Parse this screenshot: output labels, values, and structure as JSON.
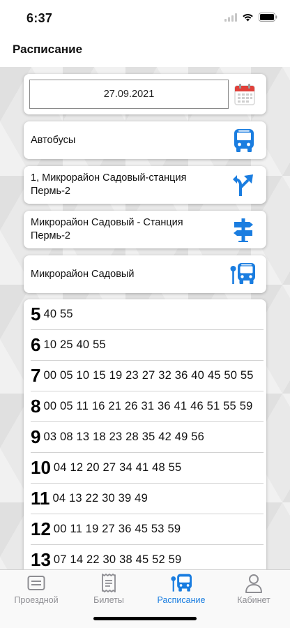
{
  "status": {
    "time": "6:37"
  },
  "nav": {
    "title": "Расписание"
  },
  "date": {
    "value": "27.09.2021"
  },
  "transport_type": {
    "label": "Автобусы"
  },
  "route": {
    "label": "1, Микрорайон Садовый-станция Пермь-2"
  },
  "direction": {
    "label": "Микрорайон Садовый - Станция Пермь-2"
  },
  "stop": {
    "label": "Микрорайон Садовый"
  },
  "schedule": [
    {
      "hour": "5",
      "minutes": "40 55"
    },
    {
      "hour": "6",
      "minutes": "10 25 40 55"
    },
    {
      "hour": "7",
      "minutes": "00 05 10 15 19 23 27 32 36 40 45 50 55"
    },
    {
      "hour": "8",
      "minutes": "00 05 11 16 21 26 31 36 41 46 51 55 59"
    },
    {
      "hour": "9",
      "minutes": "03 08 13 18 23 28 35 42 49 56"
    },
    {
      "hour": "10",
      "minutes": "04 12 20 27 34 41 48 55"
    },
    {
      "hour": "11",
      "minutes": "04 13 22 30 39 49"
    },
    {
      "hour": "12",
      "minutes": "00 11 19 27 36 45 53 59"
    },
    {
      "hour": "13",
      "minutes": "07 14 22 30 38 45 52 59"
    }
  ],
  "tabs": [
    {
      "label": "Проездной",
      "icon": "card-icon"
    },
    {
      "label": "Билеты",
      "icon": "receipt-icon"
    },
    {
      "label": "Расписание",
      "icon": "bus-stop-icon",
      "active": true
    },
    {
      "label": "Кабинет",
      "icon": "person-icon"
    }
  ],
  "colors": {
    "accent": "#1a7de0",
    "inactive": "#8e8e93",
    "calendar_red": "#e0403a"
  }
}
